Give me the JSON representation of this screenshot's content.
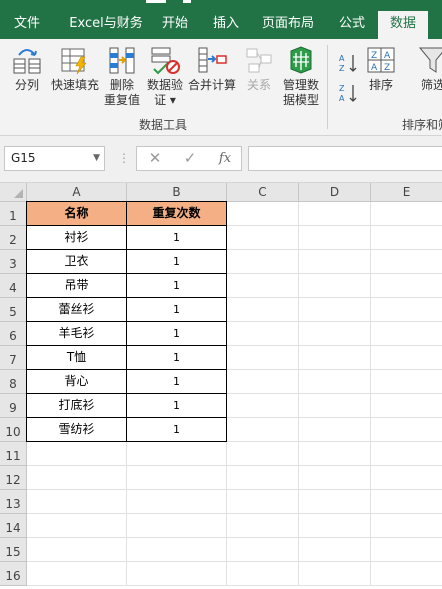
{
  "ribbon_tabs": [
    {
      "label": "文件",
      "active": false
    },
    {
      "label": "Excel与财务",
      "active": false
    },
    {
      "label": "开始",
      "active": false
    },
    {
      "label": "插入",
      "active": false
    },
    {
      "label": "页面布局",
      "active": false
    },
    {
      "label": "公式",
      "active": false
    },
    {
      "label": "数据",
      "active": true
    }
  ],
  "ribbon": {
    "data_tools": {
      "group_label": "数据工具",
      "buttons": [
        {
          "label": "分列",
          "icon": "text-to-columns-icon",
          "disabled": false
        },
        {
          "label": "快速填充",
          "icon": "flash-fill-icon",
          "disabled": false
        },
        {
          "label": "删除\n重复值",
          "icon": "remove-duplicates-icon",
          "disabled": false
        },
        {
          "label": "数据验\n证 ▾",
          "icon": "data-validation-icon",
          "disabled": false
        },
        {
          "label": "合并计算",
          "icon": "consolidate-icon",
          "disabled": false
        },
        {
          "label": "关系",
          "icon": "relationships-icon",
          "disabled": true
        },
        {
          "label": "管理数\n据模型",
          "icon": "data-model-icon",
          "disabled": false
        }
      ]
    },
    "sort_filter": {
      "group_label": "排序和筛",
      "sort_label": "排序",
      "filter_label": "筛选",
      "sort_az_icon": "sort-ascending-icon",
      "sort_za_icon": "sort-descending-icon"
    }
  },
  "formula_bar": {
    "name_box": "G15",
    "cancel_glyph": "✕",
    "enter_glyph": "✓",
    "fx_glyph": "fx",
    "formula": ""
  },
  "columns": [
    "A",
    "B",
    "C",
    "D",
    "E"
  ],
  "rows": [
    "1",
    "2",
    "3",
    "4",
    "5",
    "6",
    "7",
    "8",
    "9",
    "10",
    "11",
    "12",
    "13",
    "14",
    "15",
    "16"
  ],
  "table": {
    "headers": [
      "名称",
      "重复次数"
    ],
    "rows": [
      [
        "衬衫",
        "1"
      ],
      [
        "卫衣",
        "1"
      ],
      [
        "吊带",
        "1"
      ],
      [
        "蕾丝衫",
        "1"
      ],
      [
        "羊毛衫",
        "1"
      ],
      [
        "T恤",
        "1"
      ],
      [
        "背心",
        "1"
      ],
      [
        "打底衫",
        "1"
      ],
      [
        "雪纺衫",
        "1"
      ]
    ]
  },
  "colors": {
    "excel_green": "#217346",
    "header_fill": "#f4b084",
    "ribbon_bg": "#f3f3f3"
  }
}
